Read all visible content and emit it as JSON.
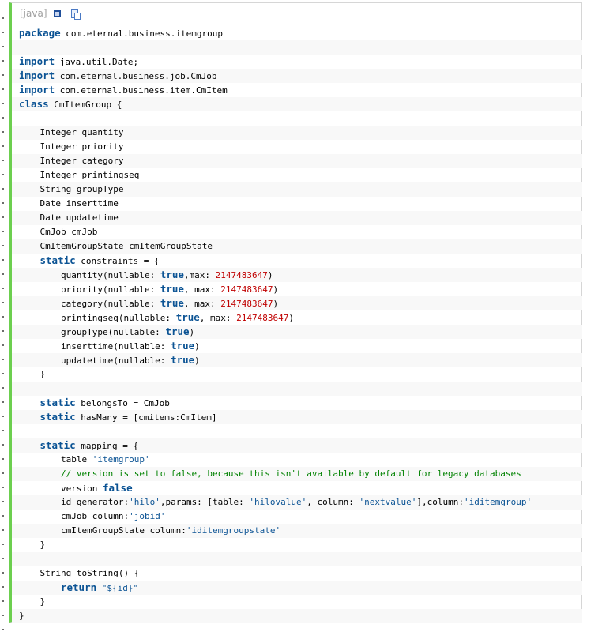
{
  "toolbar": {
    "language_label": "[java]",
    "view_source_icon": "view-source-icon",
    "copy_icon": "copy-icon"
  },
  "colors": {
    "accent_bar": "#6ccf4f",
    "keyword": "#0b5394",
    "number": "#c00000",
    "string": "#0b5394",
    "comment": "#008200"
  },
  "code_lines": [
    [
      {
        "t": "kw",
        "v": "package"
      },
      {
        "t": "p",
        "v": " com.eternal.business.itemgroup"
      }
    ],
    [],
    [
      {
        "t": "kw",
        "v": "import"
      },
      {
        "t": "p",
        "v": " java.util.Date;"
      }
    ],
    [
      {
        "t": "kw",
        "v": "import"
      },
      {
        "t": "p",
        "v": " com.eternal.business.job.CmJob"
      }
    ],
    [
      {
        "t": "kw",
        "v": "import"
      },
      {
        "t": "p",
        "v": " com.eternal.business.item.CmItem"
      }
    ],
    [
      {
        "t": "kw",
        "v": "class"
      },
      {
        "t": "p",
        "v": " CmItemGroup {"
      }
    ],
    [],
    [
      {
        "t": "p",
        "v": "    Integer quantity"
      }
    ],
    [
      {
        "t": "p",
        "v": "    Integer priority"
      }
    ],
    [
      {
        "t": "p",
        "v": "    Integer category"
      }
    ],
    [
      {
        "t": "p",
        "v": "    Integer printingseq"
      }
    ],
    [
      {
        "t": "p",
        "v": "    String groupType"
      }
    ],
    [
      {
        "t": "p",
        "v": "    Date inserttime"
      }
    ],
    [
      {
        "t": "p",
        "v": "    Date updatetime"
      }
    ],
    [
      {
        "t": "p",
        "v": "    CmJob cmJob"
      }
    ],
    [
      {
        "t": "p",
        "v": "    CmItemGroupState cmItemGroupState"
      }
    ],
    [
      {
        "t": "p",
        "v": "    "
      },
      {
        "t": "kw",
        "v": "static"
      },
      {
        "t": "p",
        "v": " constraints = {"
      }
    ],
    [
      {
        "t": "p",
        "v": "        quantity(nullable: "
      },
      {
        "t": "kw",
        "v": "true"
      },
      {
        "t": "p",
        "v": ",max: "
      },
      {
        "t": "num",
        "v": "2147483647"
      },
      {
        "t": "p",
        "v": ")"
      }
    ],
    [
      {
        "t": "p",
        "v": "        priority(nullable: "
      },
      {
        "t": "kw",
        "v": "true"
      },
      {
        "t": "p",
        "v": ", max: "
      },
      {
        "t": "num",
        "v": "2147483647"
      },
      {
        "t": "p",
        "v": ")"
      }
    ],
    [
      {
        "t": "p",
        "v": "        category(nullable: "
      },
      {
        "t": "kw",
        "v": "true"
      },
      {
        "t": "p",
        "v": ", max: "
      },
      {
        "t": "num",
        "v": "2147483647"
      },
      {
        "t": "p",
        "v": ")"
      }
    ],
    [
      {
        "t": "p",
        "v": "        printingseq(nullable: "
      },
      {
        "t": "kw",
        "v": "true"
      },
      {
        "t": "p",
        "v": ", max: "
      },
      {
        "t": "num",
        "v": "2147483647"
      },
      {
        "t": "p",
        "v": ")"
      }
    ],
    [
      {
        "t": "p",
        "v": "        groupType(nullable: "
      },
      {
        "t": "kw",
        "v": "true"
      },
      {
        "t": "p",
        "v": ")"
      }
    ],
    [
      {
        "t": "p",
        "v": "        inserttime(nullable: "
      },
      {
        "t": "kw",
        "v": "true"
      },
      {
        "t": "p",
        "v": ")"
      }
    ],
    [
      {
        "t": "p",
        "v": "        updatetime(nullable: "
      },
      {
        "t": "kw",
        "v": "true"
      },
      {
        "t": "p",
        "v": ")"
      }
    ],
    [
      {
        "t": "p",
        "v": "    }"
      }
    ],
    [],
    [
      {
        "t": "p",
        "v": "    "
      },
      {
        "t": "kw",
        "v": "static"
      },
      {
        "t": "p",
        "v": " belongsTo = CmJob"
      }
    ],
    [
      {
        "t": "p",
        "v": "    "
      },
      {
        "t": "kw",
        "v": "static"
      },
      {
        "t": "p",
        "v": " hasMany = [cmitems:CmItem]"
      }
    ],
    [],
    [
      {
        "t": "p",
        "v": "    "
      },
      {
        "t": "kw",
        "v": "static"
      },
      {
        "t": "p",
        "v": " mapping = {"
      }
    ],
    [
      {
        "t": "p",
        "v": "        table "
      },
      {
        "t": "str",
        "v": "'itemgroup'"
      }
    ],
    [
      {
        "t": "cmt",
        "v": "        // version is set to false, because this isn't available by default for legacy databases"
      }
    ],
    [
      {
        "t": "p",
        "v": "        version "
      },
      {
        "t": "kw",
        "v": "false"
      }
    ],
    [
      {
        "t": "p",
        "v": "        id generator:"
      },
      {
        "t": "str",
        "v": "'hilo'"
      },
      {
        "t": "p",
        "v": ",params: [table: "
      },
      {
        "t": "str",
        "v": "'hilovalue'"
      },
      {
        "t": "p",
        "v": ", column: "
      },
      {
        "t": "str",
        "v": "'nextvalue'"
      },
      {
        "t": "p",
        "v": "],column:"
      },
      {
        "t": "str",
        "v": "'iditemgroup'"
      }
    ],
    [
      {
        "t": "p",
        "v": "        cmJob column:"
      },
      {
        "t": "str",
        "v": "'jobid'"
      }
    ],
    [
      {
        "t": "p",
        "v": "        cmItemGroupState column:"
      },
      {
        "t": "str",
        "v": "'iditemgroupstate'"
      }
    ],
    [
      {
        "t": "p",
        "v": "    }"
      }
    ],
    [],
    [
      {
        "t": "p",
        "v": "    String toString() {"
      }
    ],
    [
      {
        "t": "p",
        "v": "        "
      },
      {
        "t": "kw",
        "v": "return"
      },
      {
        "t": "p",
        "v": " "
      },
      {
        "t": "str",
        "v": "\"${id}\""
      }
    ],
    [
      {
        "t": "p",
        "v": "    }"
      }
    ],
    [
      {
        "t": "p",
        "v": "}"
      }
    ]
  ]
}
